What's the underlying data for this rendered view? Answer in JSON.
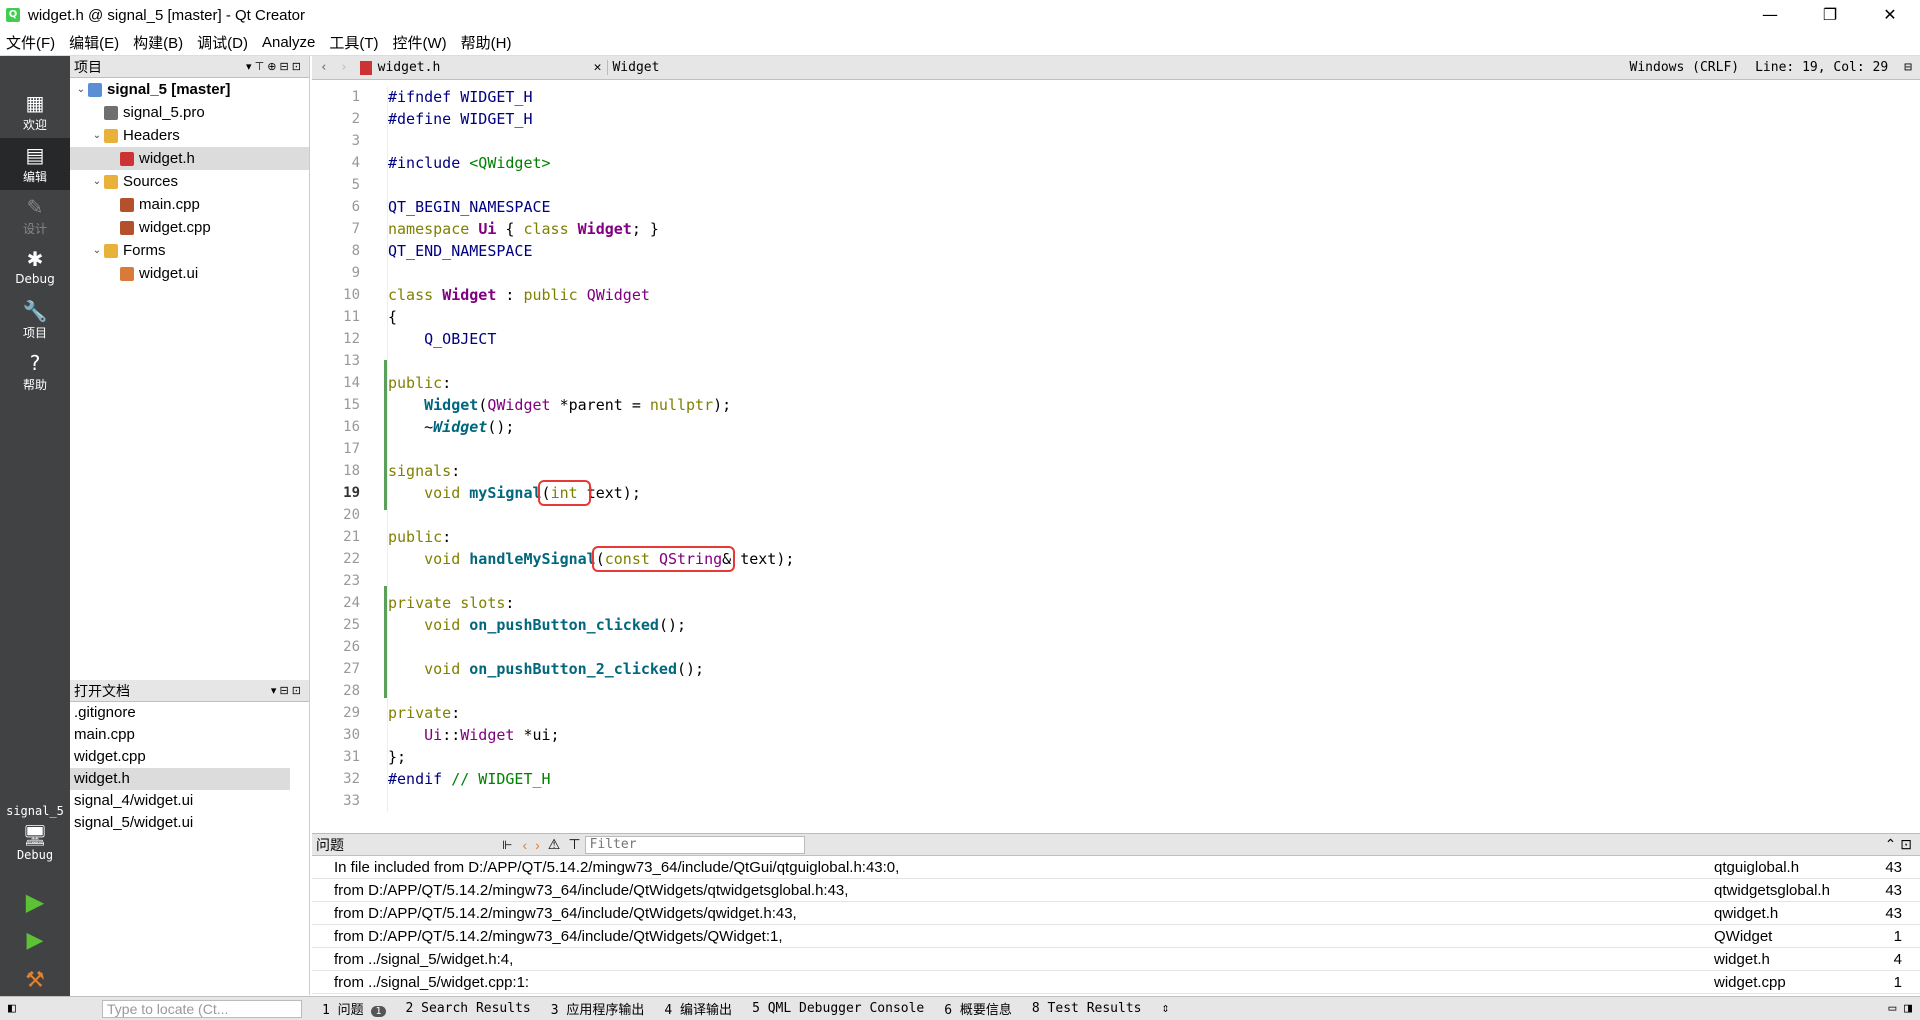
{
  "window": {
    "title": "widget.h @ signal_5 [master] - Qt Creator",
    "min": "—",
    "max": "❐",
    "close": "✕"
  },
  "menu": [
    "文件(F)",
    "编辑(E)",
    "构建(B)",
    "调试(D)",
    "Analyze",
    "工具(T)",
    "控件(W)",
    "帮助(H)"
  ],
  "modes": [
    {
      "label": "欢迎",
      "icon": "grid-icon"
    },
    {
      "label": "编辑",
      "icon": "edit-icon"
    },
    {
      "label": "设计",
      "icon": "design-icon"
    },
    {
      "label": "Debug",
      "icon": "debug-icon"
    },
    {
      "label": "项目",
      "icon": "wrench-icon"
    },
    {
      "label": "帮助",
      "icon": "help-icon"
    }
  ],
  "kit": {
    "project": "signal_5",
    "mode": "Debug"
  },
  "project_panel": {
    "title": "项目",
    "tree": [
      {
        "label": "signal_5 [master]",
        "level": 0,
        "type": "project",
        "bold": true
      },
      {
        "label": "signal_5.pro",
        "level": 1,
        "type": "pro"
      },
      {
        "label": "Headers",
        "level": 1,
        "type": "folder"
      },
      {
        "label": "widget.h",
        "level": 2,
        "type": "h",
        "selected": true
      },
      {
        "label": "Sources",
        "level": 1,
        "type": "folder"
      },
      {
        "label": "main.cpp",
        "level": 2,
        "type": "cpp"
      },
      {
        "label": "widget.cpp",
        "level": 2,
        "type": "cpp"
      },
      {
        "label": "Forms",
        "level": 1,
        "type": "folder"
      },
      {
        "label": "widget.ui",
        "level": 2,
        "type": "ui"
      }
    ]
  },
  "open_docs": {
    "title": "打开文档",
    "items": [
      ".gitignore",
      "main.cpp",
      "widget.cpp",
      "widget.h",
      "signal_4/widget.ui",
      "signal_5/widget.ui"
    ],
    "selected": 3
  },
  "editor": {
    "file": "widget.h",
    "symbol": "Widget",
    "encoding": "Windows (CRLF)",
    "position": "Line: 19, Col: 29",
    "current_line": 19
  },
  "issues": {
    "title": "问题",
    "filter_placeholder": "Filter",
    "rows": [
      {
        "msg": "In file included from D:/APP/QT/5.14.2/mingw73_64/include/QtGui/qtguiglobal.h:43:0,",
        "file": "qtguiglobal.h",
        "line": "43"
      },
      {
        "msg": "from D:/APP/QT/5.14.2/mingw73_64/include/QtWidgets/qtwidgetsglobal.h:43,",
        "file": "qtwidgetsglobal.h",
        "line": "43"
      },
      {
        "msg": "from D:/APP/QT/5.14.2/mingw73_64/include/QtWidgets/qwidget.h:43,",
        "file": "qwidget.h",
        "line": "43"
      },
      {
        "msg": "from D:/APP/QT/5.14.2/mingw73_64/include/QtWidgets/QWidget:1,",
        "file": "QWidget",
        "line": "1"
      },
      {
        "msg": "from ../signal_5/widget.h:4,",
        "file": "widget.h",
        "line": "4"
      },
      {
        "msg": "from ../signal_5/widget.cpp:1:",
        "file": "widget.cpp",
        "line": "1"
      }
    ]
  },
  "statusbar": {
    "locate_placeholder": "Type to locate (Ct...",
    "tabs": [
      "1 问题",
      "2 Search Results",
      "3 应用程序输出",
      "4 编译输出",
      "5 QML Debugger Console",
      "6 概要信息",
      "8 Test Results"
    ],
    "issues_count": "1"
  }
}
